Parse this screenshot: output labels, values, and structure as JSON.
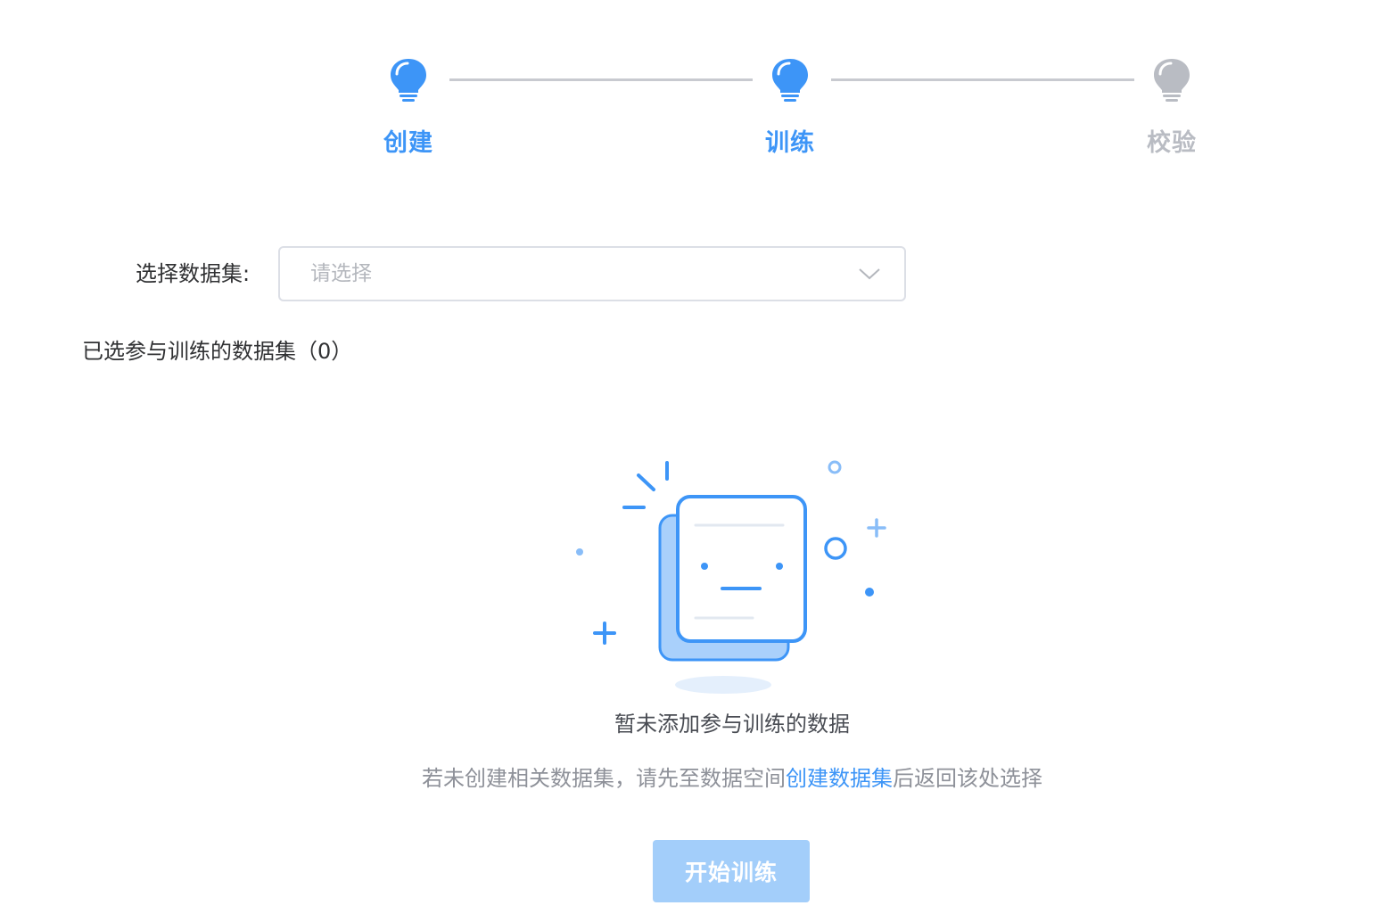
{
  "steps": [
    {
      "label": "创建",
      "status": "active",
      "icon": "lightbulb-icon"
    },
    {
      "label": "训练",
      "status": "active",
      "icon": "lightbulb-icon"
    },
    {
      "label": "校验",
      "status": "inactive",
      "icon": "lightbulb-icon"
    }
  ],
  "form": {
    "dataset_label": "选择数据集:",
    "dataset_placeholder": "请选择",
    "dataset_value": ""
  },
  "selected": {
    "title": "已选参与训练的数据集（0）",
    "count": 0
  },
  "empty": {
    "title": "暂未添加参与训练的数据",
    "hint_before": "若未创建相关数据集，请先至数据空间",
    "hint_link": "创建数据集",
    "hint_after": "后返回该处选择"
  },
  "actions": {
    "start_label": "开始训练",
    "start_disabled": true
  },
  "colors": {
    "accent": "#3d95f7",
    "inactive": "#b9bcc3",
    "disabled_button": "#a3cefa",
    "illustration_fill": "#a9d0fb"
  }
}
